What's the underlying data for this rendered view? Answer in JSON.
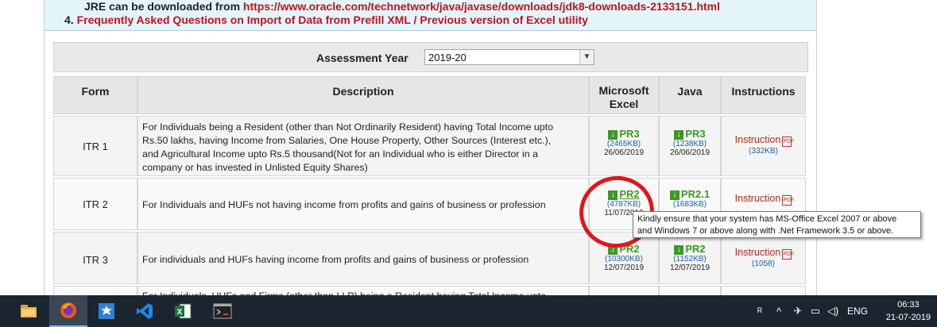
{
  "info": {
    "line1_text": "JRE can be downloaded from",
    "line1_url": "https://www.oracle.com/technetwork/java/javase/downloads/jdk8-downloads-2133151.html",
    "line2_num": "4.",
    "line2_link": "Frequently Asked Questions on Import of Data from Prefill XML / Previous version of Excel utility"
  },
  "assessment_year": {
    "label": "Assessment Year",
    "value": "2019-20"
  },
  "table": {
    "headers": {
      "form": "Form",
      "description": "Description",
      "excel_line1": "Microsoft",
      "excel_line2": "Excel",
      "java": "Java",
      "instructions": "Instructions"
    },
    "rows": [
      {
        "form": "ITR 1",
        "desc_lines": [
          "For Individuals being a Resident (other than Not Ordinarily Resident) having Total Income upto",
          "Rs.50 lakhs, having Income from Salaries, One House Property, Other Sources (Interest etc.),",
          "and Agricultural Income upto Rs.5 thousand(Not for an Individual who is either Director in a",
          "company or has invested in Unlisted Equity Shares)"
        ],
        "excel": {
          "label": "PR3",
          "size": "(2465KB)",
          "date": "26/06/2019"
        },
        "java": {
          "label": "PR3",
          "size": "(1238KB)",
          "date": "26/06/2019"
        },
        "instr": {
          "label": "Instruction",
          "size": "(332KB)"
        }
      },
      {
        "form": "ITR 2",
        "desc_lines": [
          "For Individuals and HUFs not having income from profits and gains of business or profession"
        ],
        "excel": {
          "label": "PR2",
          "size": "(4787KB)",
          "date": "11/07/2019"
        },
        "java": {
          "label": "PR2.1",
          "size": "(1683KB)",
          "date": ""
        },
        "instr": {
          "label": "Instruction",
          "size": ""
        }
      },
      {
        "form": "ITR 3",
        "desc_lines": [
          "For individuals and HUFs having income from profits and gains of business or profession"
        ],
        "excel": {
          "label": "PR2",
          "size": "(10300KB)",
          "date": "12/07/2019"
        },
        "java": {
          "label": "PR2",
          "size": "(1152KB)",
          "date": "12/07/2019"
        },
        "instr": {
          "label": "Instruction",
          "size": "(1058)"
        }
      },
      {
        "form": "",
        "desc_lines": [
          "For Individuals, HUFs and Firms (other than LLP) being a Resident having Total Income upto"
        ]
      }
    ]
  },
  "tooltip": {
    "line1": "Kindly ensure that your system has MS-Office Excel 2007 or  above",
    "line2": "and Windows 7 or above along with .Net Framework 3.5 or above."
  },
  "taskbar": {
    "apps": [
      "file-explorer",
      "firefox",
      "app-gear",
      "visual-studio-code",
      "excel",
      "command-prompt"
    ],
    "language": "ENG",
    "time": "06:33",
    "date": "21-07-2019"
  },
  "colors": {
    "accent_red": "#c0131a",
    "download_green": "#3a9a23",
    "link_blue": "#2060b0",
    "annotation_red": "#e3141a"
  }
}
